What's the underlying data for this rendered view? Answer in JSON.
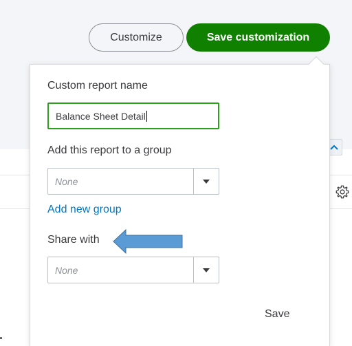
{
  "header": {
    "customize_label": "Customize",
    "save_customization_label": "Save customization"
  },
  "popover": {
    "report_name_label": "Custom report name",
    "report_name_value": "Balance Sheet Detail",
    "group_label": "Add this report to a group",
    "group_value": "None",
    "add_group_link": "Add new group",
    "share_label": "Share with",
    "share_value": "None",
    "save_label": "Save"
  },
  "colors": {
    "primary_green": "#108000",
    "focus_green": "#2ca01c",
    "link_blue": "#0077c5",
    "annotation_arrow": "#5b9bd5"
  },
  "icons": [
    "gear-icon",
    "chevron-up-icon",
    "dropdown-arrow-icon",
    "annotation-arrow"
  ]
}
